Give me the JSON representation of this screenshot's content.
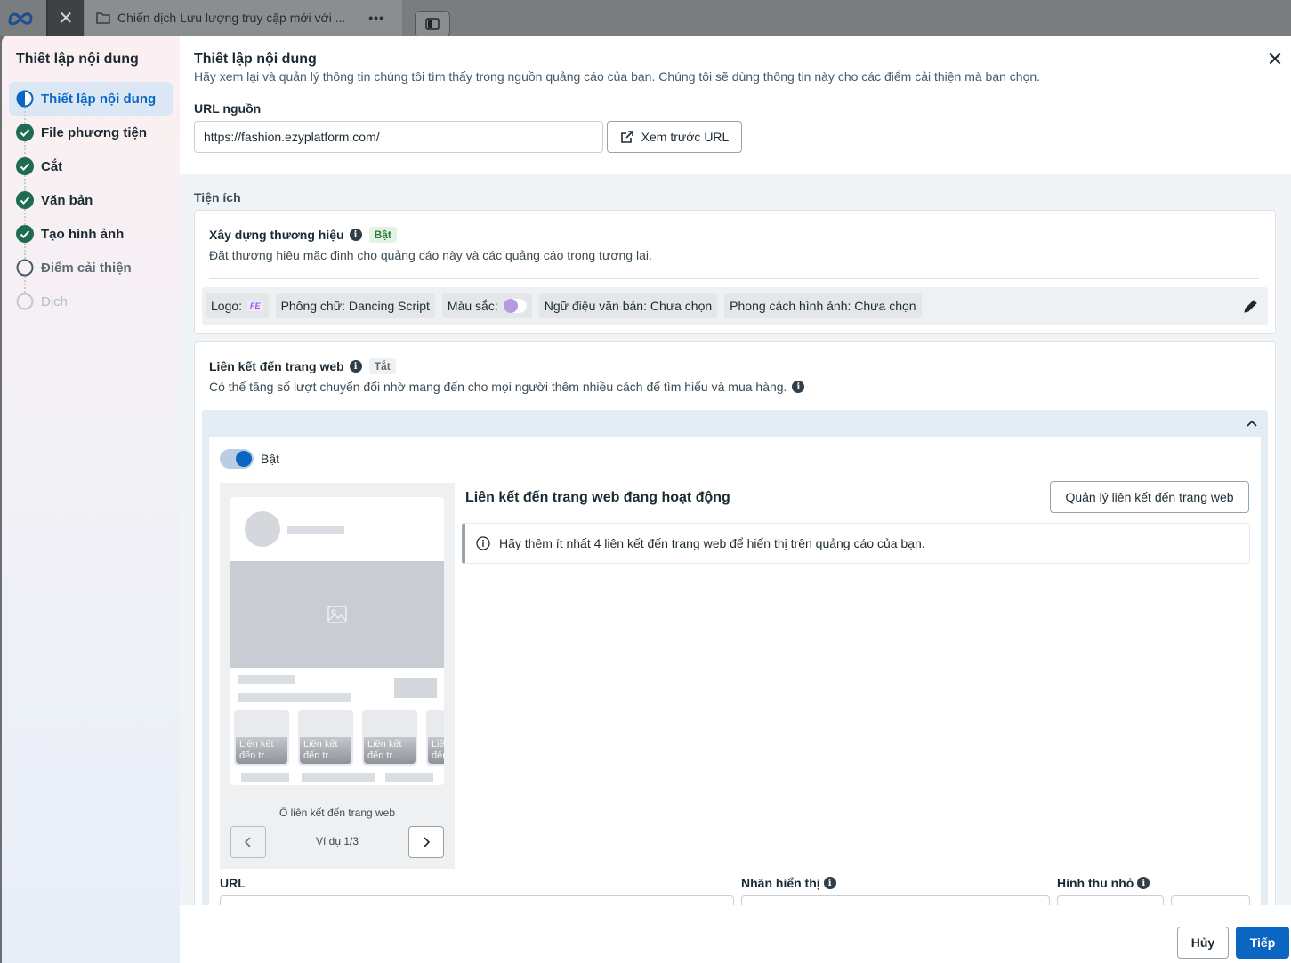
{
  "topbar": {
    "tab_title": "Chiến dịch Lưu lượng truy cập mới với ...",
    "tab_more": "•••",
    "close_glyph": "✕"
  },
  "sidebar": {
    "title": "Thiết lập nội dung",
    "steps": [
      {
        "label": "Thiết lập nội dung",
        "state": "active"
      },
      {
        "label": "File phương tiện",
        "state": "done"
      },
      {
        "label": "Cắt",
        "state": "done"
      },
      {
        "label": "Văn bản",
        "state": "done"
      },
      {
        "label": "Tạo hình ảnh",
        "state": "done"
      },
      {
        "label": "Điểm cải thiện",
        "state": "pending"
      },
      {
        "label": "Dịch",
        "state": "disabled"
      }
    ]
  },
  "header": {
    "title": "Thiết lập nội dung",
    "subtitle": "Hãy xem lại và quản lý thông tin chúng tôi tìm thấy trong nguồn quảng cáo của bạn. Chúng tôi sẽ dùng thông tin này cho các điểm cải thiện mà bạn chọn.",
    "close_glyph": "✕"
  },
  "source_url": {
    "label": "URL nguồn",
    "value": "https://fashion.ezyplatform.com/",
    "preview_button": "Xem trước URL"
  },
  "utilities": {
    "label": "Tiện ích",
    "branding": {
      "title": "Xây dựng thương hiệu",
      "badge": "Bật",
      "description": "Đặt thương hiệu mặc định cho quảng cáo này và các quảng cáo trong tương lai.",
      "chips": {
        "logo_label": "Logo:",
        "logo_mark": "FE",
        "font": "Phông chữ: Dancing Script",
        "color_label": "Màu sắc:",
        "tone": "Ngữ điệu văn bản: Chưa chọn",
        "image_style": "Phong cách hình ảnh: Chưa chọn"
      }
    },
    "site_links": {
      "title": "Liên kết đến trang web",
      "badge": "Tắt",
      "description": "Có thể tăng số lượt chuyển đổi nhờ mang đến cho mọi người thêm nhiều cách để tìm hiểu và mua hàng.",
      "toggle_label": "Bật",
      "mockup": {
        "card_label": "Liên kết đến tr...",
        "caption": "Ô liên kết đến trang web",
        "counter": "Ví dụ 1/3"
      },
      "active_title": "Liên kết đến trang web đang hoạt động",
      "manage_button": "Quản lý liên kết đến trang web",
      "notice": "Hãy thêm ít nhất 4 liên kết đến trang web để hiển thị trên quảng cáo của bạn.",
      "fields": {
        "url": "URL",
        "display_label": "Nhãn hiển thị",
        "thumbnail": "Hình thu nhỏ"
      }
    }
  },
  "footer": {
    "cancel": "Hủy",
    "next": "Tiếp"
  },
  "colors": {
    "accent": "#0a66c2",
    "done_green": "#1f6b4f",
    "brand_color": "#b69ae0"
  }
}
